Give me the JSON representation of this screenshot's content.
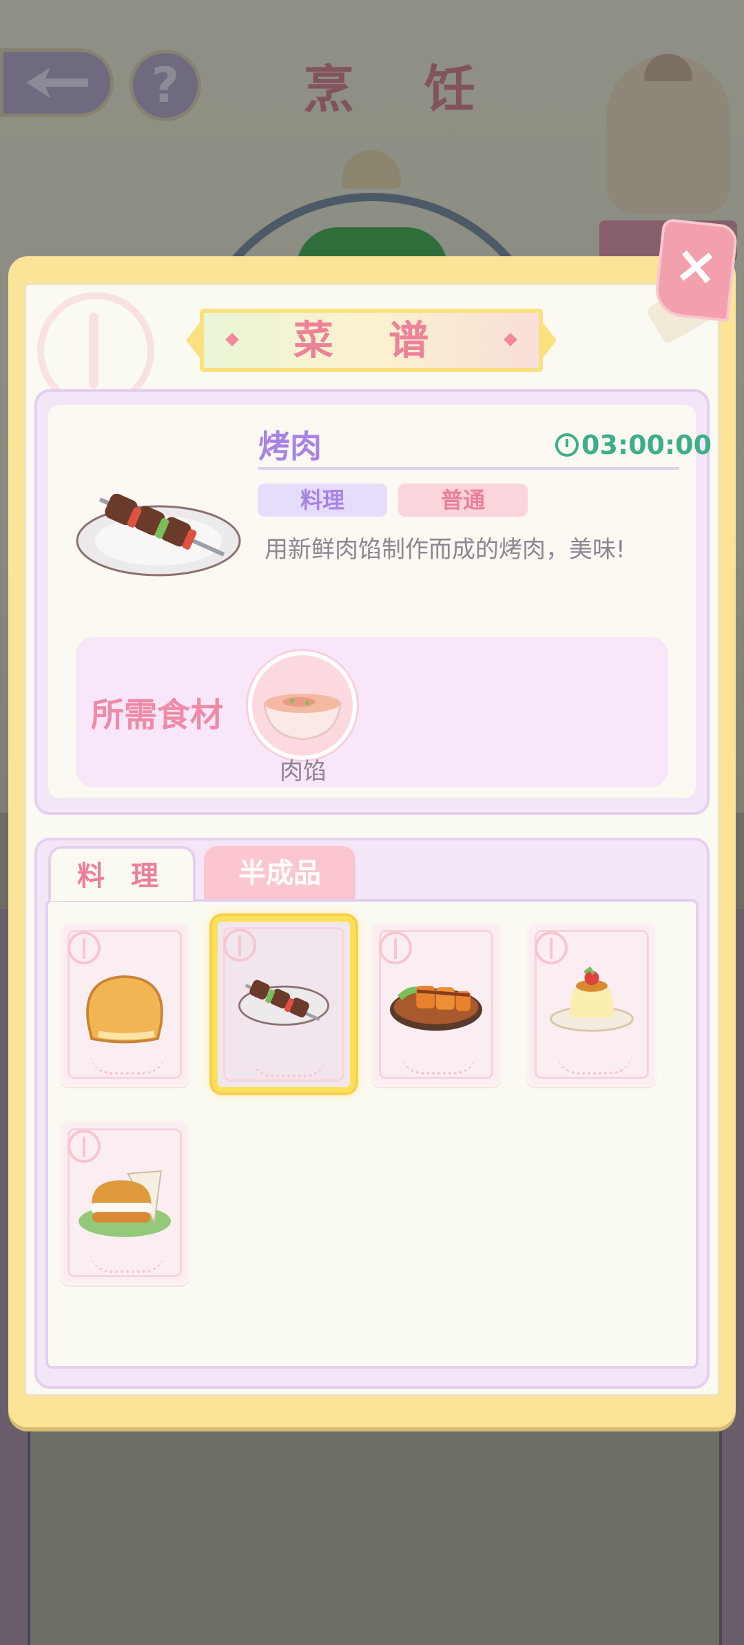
{
  "background": {
    "title": "烹 饪",
    "help_label": "?"
  },
  "dialog": {
    "close_label": "×",
    "title": "菜 谱"
  },
  "recipe": {
    "name": "烤肉",
    "time": "03:00:00",
    "category_tag": "料理",
    "rarity_tag": "普通",
    "description": "用新鲜肉馅制作而成的烤肉，美味!",
    "ingredients_label": "所需食材",
    "ingredients": [
      {
        "name": "肉馅",
        "icon": "meat-filling-bowl-icon"
      }
    ]
  },
  "tabs": [
    {
      "label": "料 理",
      "active": true
    },
    {
      "label": "半成品",
      "active": false
    }
  ],
  "items": [
    {
      "icon": "bread-icon",
      "selected": false
    },
    {
      "icon": "skewer-icon",
      "selected": true
    },
    {
      "icon": "tonkatsu-icon",
      "selected": false
    },
    {
      "icon": "pudding-icon",
      "selected": false
    },
    {
      "icon": "burger-icon",
      "selected": false
    }
  ],
  "colors": {
    "dialog_border": "#fbe398",
    "title_pink": "#ec8197",
    "name_purple": "#a883e6",
    "timer_green": "#3cae8b",
    "selected_gold": "#fbe15a"
  }
}
